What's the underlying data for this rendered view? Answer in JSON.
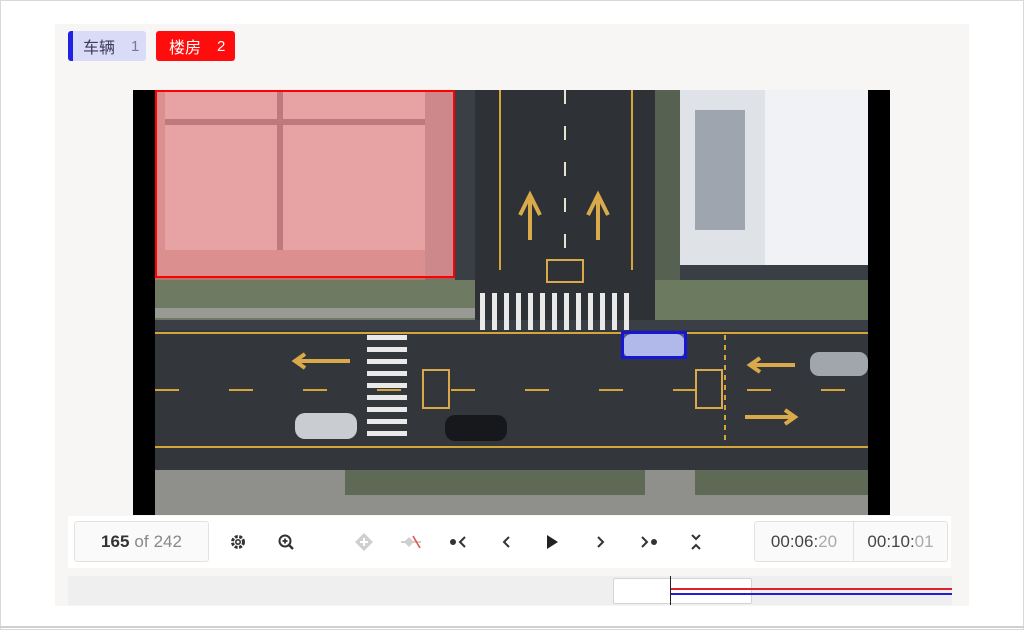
{
  "labels": [
    {
      "name": "车辆",
      "count": "1",
      "color": "#1f22e0"
    },
    {
      "name": "楼房",
      "count": "2",
      "color": "#ff0d0d"
    }
  ],
  "toolbar": {
    "frame_current": "165",
    "frame_of": "of",
    "frame_total": "242",
    "time_current_main": "00:06:",
    "time_current_frac": "20",
    "time_total_main": "00:10:",
    "time_total_frac": "01",
    "icons": [
      "gear-icon",
      "zoom-in-icon",
      "add-keyframe-icon",
      "remove-keyframe-icon",
      "prev-keyframe-icon",
      "prev-frame-icon",
      "play-icon",
      "next-frame-icon",
      "next-keyframe-icon",
      "collapse-icon"
    ]
  },
  "colors": {
    "vehicle_box": "#1616d9",
    "building_box": "#ff0000",
    "timeline_building_track": "#e0202a",
    "timeline_vehicle_track": "#2020d8"
  }
}
